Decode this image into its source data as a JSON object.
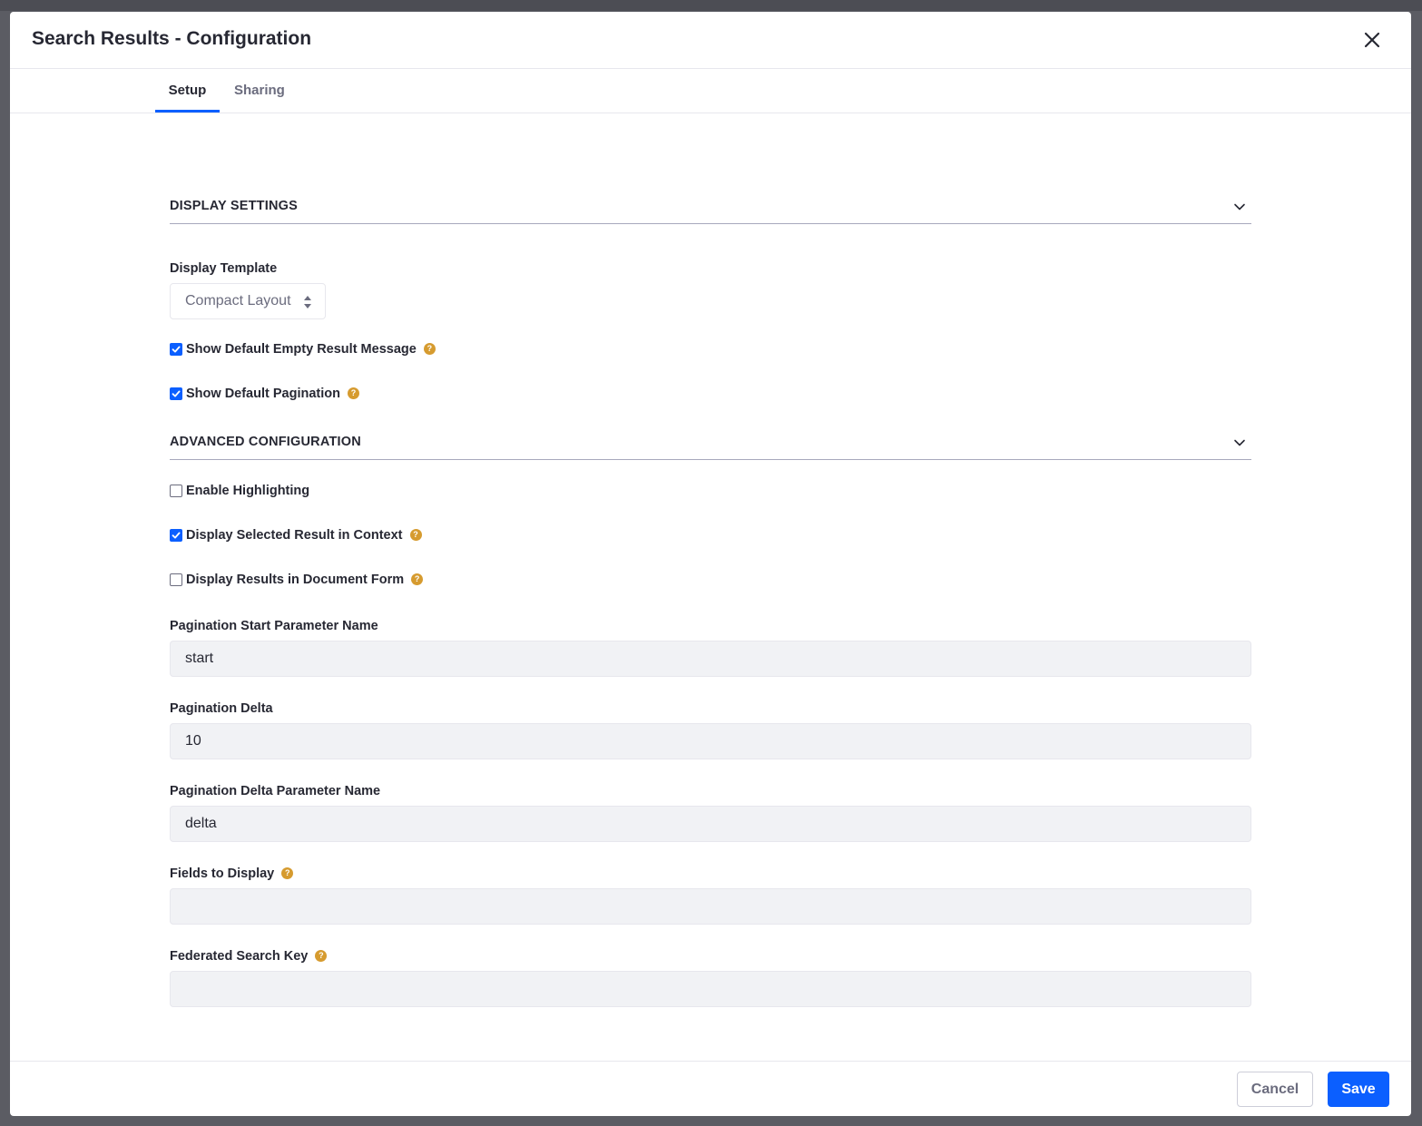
{
  "modal": {
    "title": "Search Results - Configuration",
    "close_icon": "close-icon"
  },
  "tabs": [
    {
      "label": "Setup",
      "active": true
    },
    {
      "label": "Sharing",
      "active": false
    }
  ],
  "display_settings": {
    "title": "DISPLAY SETTINGS",
    "display_template_label": "Display Template",
    "display_template_value": "Compact Layout",
    "show_empty_message": {
      "label": "Show Default Empty Result Message",
      "checked": true
    },
    "show_pagination": {
      "label": "Show Default Pagination",
      "checked": true
    }
  },
  "advanced": {
    "title": "ADVANCED CONFIGURATION",
    "enable_highlighting": {
      "label": "Enable Highlighting",
      "checked": false
    },
    "display_selected_in_context": {
      "label": "Display Selected Result in Context",
      "checked": true
    },
    "display_in_document_form": {
      "label": "Display Results in Document Form",
      "checked": false
    },
    "pagination_start_label": "Pagination Start Parameter Name",
    "pagination_start_value": "start",
    "pagination_delta_label": "Pagination Delta",
    "pagination_delta_value": "10",
    "pagination_delta_param_label": "Pagination Delta Parameter Name",
    "pagination_delta_param_value": "delta",
    "fields_to_display_label": "Fields to Display",
    "fields_to_display_value": "",
    "federated_key_label": "Federated Search Key",
    "federated_key_value": ""
  },
  "footer": {
    "cancel_label": "Cancel",
    "save_label": "Save"
  },
  "colors": {
    "primary": "#0b5fff",
    "help_icon": "#d69b2f",
    "backdrop": "#5b5c63"
  }
}
